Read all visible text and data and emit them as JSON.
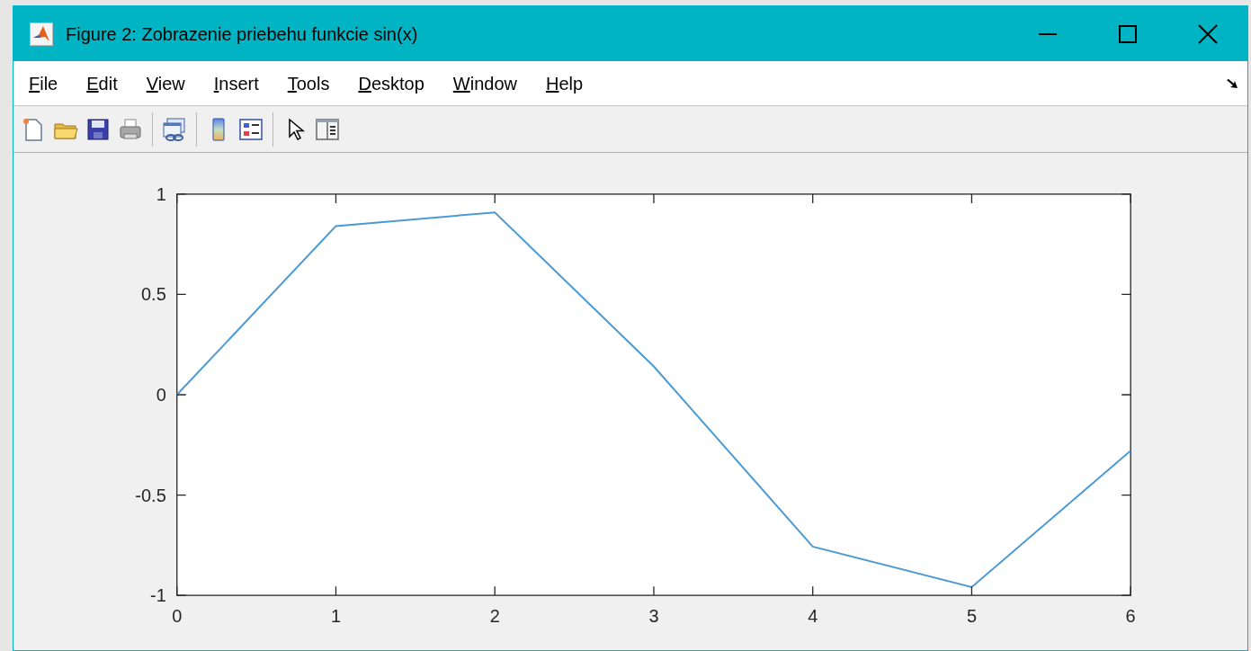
{
  "window": {
    "title": "Figure 2: Zobrazenie priebehu funkcie sin(x)"
  },
  "menu": [
    {
      "label": "File"
    },
    {
      "label": "Edit"
    },
    {
      "label": "View"
    },
    {
      "label": "Insert"
    },
    {
      "label": "Tools"
    },
    {
      "label": "Desktop"
    },
    {
      "label": "Window"
    },
    {
      "label": "Help"
    }
  ],
  "toolbar": [
    {
      "kind": "new"
    },
    {
      "kind": "open"
    },
    {
      "kind": "save"
    },
    {
      "kind": "print"
    },
    {
      "kind": "separator"
    },
    {
      "kind": "link"
    },
    {
      "kind": "separator"
    },
    {
      "kind": "colorbar"
    },
    {
      "kind": "legend"
    },
    {
      "kind": "separator"
    },
    {
      "kind": "pointer"
    },
    {
      "kind": "panel"
    }
  ],
  "plot": {
    "chart_data": {
      "type": "line",
      "x": [
        0,
        1,
        2,
        3,
        4,
        5,
        6
      ],
      "series": [
        {
          "color": "#4c9ad4",
          "values": [
            0,
            0.841,
            0.909,
            0.141,
            -0.757,
            -0.959,
            -0.279
          ]
        }
      ],
      "xlim": [
        0,
        6
      ],
      "ylim": [
        -1,
        1
      ],
      "xticks": [
        0,
        1,
        2,
        3,
        4,
        5,
        6
      ],
      "yticks": [
        {
          "value": -1,
          "label": "-1"
        },
        {
          "value": -0.5,
          "label": "-0.5"
        },
        {
          "value": 0,
          "label": "0"
        },
        {
          "value": 0.5,
          "label": "0.5"
        },
        {
          "value": 1,
          "label": "1"
        }
      ]
    }
  }
}
